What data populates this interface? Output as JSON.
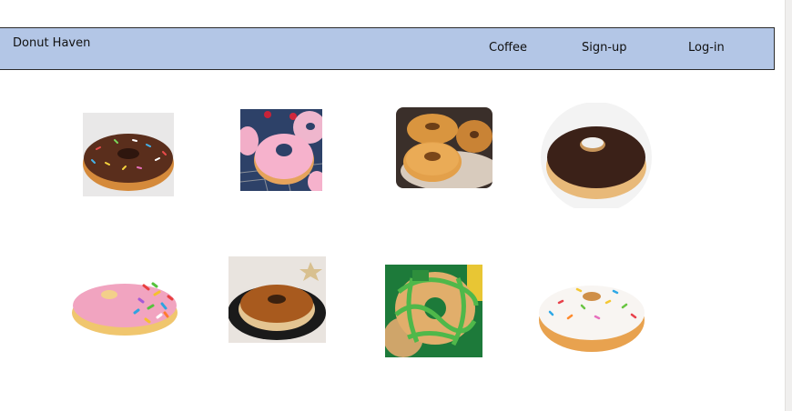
{
  "header": {
    "brand": "Donut Haven",
    "nav": [
      {
        "label": "Coffee"
      },
      {
        "label": "Sign-up"
      },
      {
        "label": "Log-in"
      }
    ]
  },
  "gallery": {
    "items": [
      {
        "alt": "chocolate frosted donut with sprinkles",
        "icon": "donut-image"
      },
      {
        "alt": "pink glazed donuts on a cooling rack",
        "icon": "donut-image"
      },
      {
        "alt": "glazed donuts on a plate",
        "icon": "donut-image"
      },
      {
        "alt": "chocolate frosted donut",
        "icon": "donut-image"
      },
      {
        "alt": "pink frosted donut with rainbow sprinkles",
        "icon": "donut-image"
      },
      {
        "alt": "caramel glazed donut on a black plate",
        "icon": "donut-image"
      },
      {
        "alt": "green drizzled festive donuts",
        "icon": "donut-image"
      },
      {
        "alt": "white frosted donut with sprinkles",
        "icon": "donut-image"
      }
    ]
  },
  "colors": {
    "navbar_bg": "#b3c6e6",
    "navbar_border": "#2b2b2b",
    "page_bg": "#ffffff"
  }
}
